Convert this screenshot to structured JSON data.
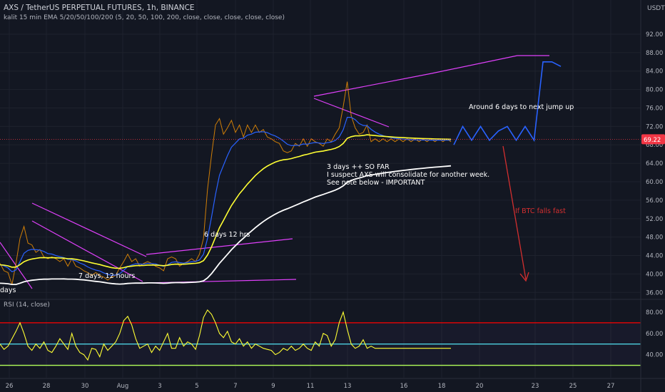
{
  "header": {
    "symbol_line": "AXS / TetherUS PERPETUAL FUTURES, 1h, BINANCE",
    "indicator_line": "kalit 15 min EMA 5/20/50/100/200 (5, 20, 50, 100, 200, close, close, close, close, close)",
    "currency": "USDT",
    "rsi_label": "RSI (14, close)"
  },
  "colors": {
    "background": "#131722",
    "grid": "#1e222d",
    "text": "#b2b5be",
    "ema_yellow": "#ffff33",
    "ema_white": "#ffffff",
    "ema_blue": "#2962ff",
    "trendline": "#e040fb",
    "projection": "#2962ff",
    "red_arrow": "#d32f2f",
    "rsi": "#ffff33",
    "rsi_upper": "#ff0000",
    "rsi_mid": "#4dd0e1",
    "rsi_lower": "#b2ff59",
    "price_tag": "#f23645"
  },
  "chart_data": [
    {
      "type": "line",
      "pane": "price",
      "y_axis_ticks": [
        "92.00",
        "88.00",
        "84.00",
        "80.00",
        "76.00",
        "72.00",
        "68.00",
        "64.00",
        "60.00",
        "56.00",
        "52.00",
        "48.00",
        "44.00",
        "40.00",
        "36.00"
      ],
      "ylim": [
        34.5,
        94
      ],
      "x_axis_ticks": [
        "26",
        "28",
        "30",
        "Aug",
        "3",
        "5",
        "7",
        "9",
        "11",
        "13",
        "Aug 16",
        "18",
        "20",
        "23",
        "25",
        "27"
      ],
      "current_price": "69.22",
      "series": [
        {
          "role": "price",
          "x": [
            0,
            2,
            4,
            6,
            8,
            10,
            12,
            14,
            16,
            18,
            20,
            22,
            24,
            26,
            28,
            30,
            32,
            34,
            36,
            38,
            40,
            42,
            44,
            46,
            48,
            50,
            52,
            54,
            56,
            58,
            60,
            62,
            64,
            66,
            68,
            70,
            72,
            74,
            76,
            78,
            80,
            82,
            84,
            86,
            88,
            90,
            92,
            94,
            96,
            98,
            100,
            102,
            104,
            106,
            108,
            110,
            112,
            114,
            116,
            118,
            120,
            122,
            124,
            126,
            128,
            130,
            132,
            134,
            136,
            138,
            140,
            142,
            144,
            146,
            148,
            150,
            152,
            154,
            156,
            158,
            160,
            162,
            164,
            166,
            168,
            170,
            172,
            174,
            176,
            178,
            180,
            182,
            184,
            186,
            188,
            190,
            192,
            194,
            196,
            198,
            200,
            202,
            204,
            206,
            208,
            210,
            212,
            214,
            216,
            218,
            220,
            222,
            224,
            226
          ],
          "y": [
            42,
            41,
            40,
            38,
            42,
            48,
            50,
            47,
            46,
            45,
            45,
            44,
            43,
            44,
            43,
            43,
            43,
            42,
            43,
            42,
            41,
            41,
            40,
            40,
            40,
            40,
            39,
            39,
            39,
            40,
            41,
            43,
            44,
            43,
            43,
            42,
            42,
            43,
            42,
            42,
            41,
            41,
            43,
            44,
            43,
            42,
            42,
            43,
            43,
            43,
            44,
            48,
            58,
            66,
            72,
            74,
            70,
            72,
            73,
            71,
            72,
            70,
            72,
            71,
            72,
            71,
            71,
            70,
            69,
            69,
            68,
            67,
            66,
            67,
            68,
            68,
            69,
            68,
            69,
            69,
            68,
            68,
            69,
            69,
            70,
            72,
            76,
            82,
            74,
            72,
            70,
            71,
            72,
            69,
            69,
            69,
            69,
            69,
            69,
            69,
            69,
            69,
            69,
            69,
            69,
            69,
            69,
            69,
            69,
            69,
            69,
            69,
            69,
            69
          ]
        },
        {
          "role": "ema_yellow",
          "y_range": [
            38,
            70
          ]
        },
        {
          "role": "ema_white",
          "y_range": [
            35,
            66
          ]
        }
      ],
      "projection": {
        "y": [
          68,
          72,
          69,
          72,
          69,
          71,
          72,
          69,
          72,
          69,
          86,
          86,
          85
        ]
      },
      "annotations": [
        "3 days ++ SO FAR",
        "I suspect AXS will consolidate for another week.",
        "See note below - IMPORTANT",
        "Around 6 days to next jump up",
        "If BTC falls fast",
        "6 days 12 hrs",
        "7 days, 12 hours",
        "days"
      ]
    },
    {
      "type": "line",
      "pane": "rsi",
      "y_axis_ticks": [
        "80.00",
        "60.00",
        "40.00"
      ],
      "ylim": [
        25,
        90
      ],
      "levels": [
        70,
        50,
        30
      ],
      "series": [
        {
          "role": "rsi",
          "y": [
            50,
            45,
            48,
            55,
            62,
            70,
            60,
            48,
            44,
            50,
            46,
            52,
            44,
            42,
            48,
            55,
            50,
            45,
            60,
            48,
            42,
            40,
            35,
            46,
            45,
            38,
            50,
            44,
            48,
            52,
            60,
            72,
            76,
            68,
            55,
            46,
            48,
            50,
            42,
            48,
            44,
            52,
            60,
            46,
            46,
            56,
            48,
            52,
            50,
            45,
            58,
            75,
            82,
            78,
            70,
            60,
            56,
            62,
            52,
            50,
            55,
            48,
            52,
            46,
            50,
            48,
            46,
            45,
            44,
            40,
            42,
            46,
            44,
            48,
            44,
            46,
            50,
            46,
            44,
            52,
            48,
            60,
            58,
            48,
            54,
            70,
            80,
            64,
            50,
            46,
            48,
            54,
            46,
            48,
            46,
            46,
            46,
            46,
            46,
            46,
            46,
            46,
            46,
            46,
            46,
            46,
            46,
            46,
            46,
            46,
            46,
            46,
            46,
            46
          ]
        }
      ]
    }
  ]
}
